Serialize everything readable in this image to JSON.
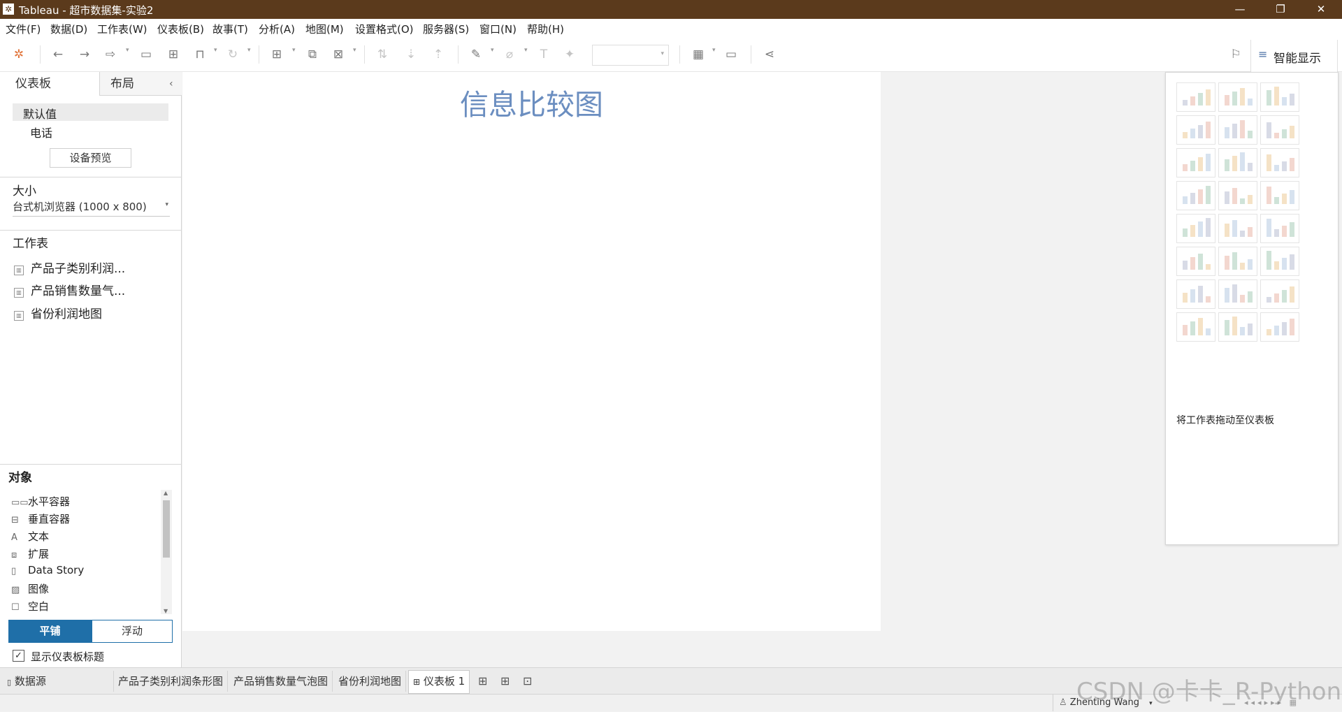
{
  "window": {
    "title": "Tableau - 超市数据集-实验2",
    "minimize": "—",
    "restore": "❐",
    "close": "✕"
  },
  "menu": [
    "文件(F)",
    "数据(D)",
    "工作表(W)",
    "仪表板(B)",
    "故事(T)",
    "分析(A)",
    "地图(M)",
    "设置格式(O)",
    "服务器(S)",
    "窗口(N)",
    "帮助(H)"
  ],
  "show_me": {
    "label": "智能显示",
    "hint": "将工作表拖动至仪表板"
  },
  "left_panel": {
    "tab_dashboard": "仪表板",
    "tab_layout": "布局",
    "devices": {
      "default": "默认值",
      "phone": "电话",
      "preview_button": "设备预览"
    },
    "size": {
      "heading": "大小",
      "value": "台式机浏览器 (1000 x 800)"
    },
    "worksheets": {
      "heading": "工作表",
      "items": [
        "产品子类别利润...",
        "产品销售数量气...",
        "省份利润地图"
      ]
    },
    "objects": {
      "heading": "对象",
      "items": [
        {
          "label": "水平容器",
          "icon": "horizontal-container-icon"
        },
        {
          "label": "垂直容器",
          "icon": "vertical-container-icon"
        },
        {
          "label": "文本",
          "icon": "text-icon"
        },
        {
          "label": "扩展",
          "icon": "extension-icon"
        },
        {
          "label": "Data Story",
          "icon": "book-icon"
        },
        {
          "label": "图像",
          "icon": "image-icon"
        },
        {
          "label": "空白",
          "icon": "blank-icon"
        }
      ],
      "tiled": "平铺",
      "floating": "浮动"
    },
    "show_title_label": "显示仪表板标题",
    "show_title_checked": true
  },
  "dashboard": {
    "title": "信息比较图"
  },
  "sheet_tabs": {
    "datasource": "数据源",
    "sheets": [
      "产品子类别利润条形图",
      "产品销售数量气泡图",
      "省份利润地图",
      "仪表板 1"
    ],
    "active": "仪表板 1"
  },
  "status": {
    "user": "Zhenting Wang",
    "watermark": "CSDN @卡卡_R-Python"
  },
  "colors": {
    "titlebar": "#5b3a1c",
    "accent": "#1f6fa8",
    "dash_title": "#6b8ec0"
  }
}
